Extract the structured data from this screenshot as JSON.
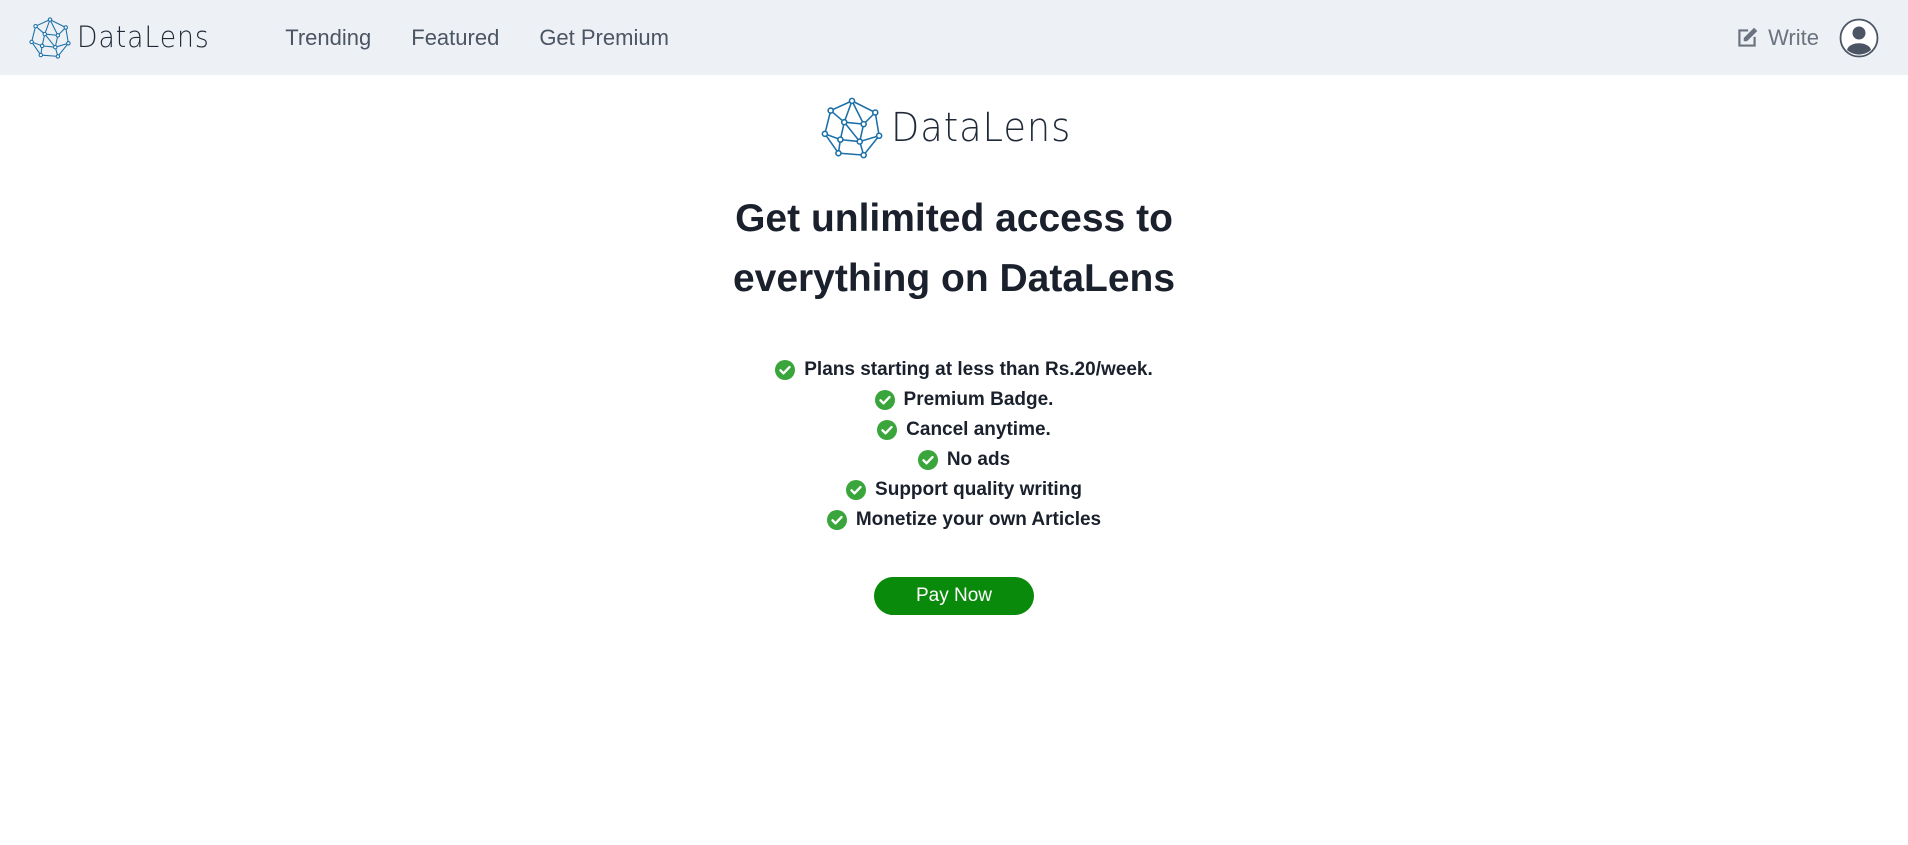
{
  "navbar": {
    "brand": {
      "name": "DataLens",
      "icon": "network-logo-icon"
    },
    "links": [
      {
        "label": "Trending"
      },
      {
        "label": "Featured"
      },
      {
        "label": "Get Premium"
      }
    ],
    "write": {
      "label": "Write",
      "icon": "edit-icon"
    },
    "avatar": {
      "icon": "user-avatar-icon"
    }
  },
  "main": {
    "logo_text": "DataLens",
    "headline": "Get unlimited access to everything on DataLens",
    "features": [
      "Plans starting at less than Rs.20/week.",
      "Premium Badge.",
      "Cancel anytime.",
      "No ads",
      "Support quality writing",
      "Monetize your own Articles"
    ],
    "pay_button_label": "Pay Now"
  },
  "colors": {
    "navbar_bg": "#edf1f5",
    "logo_blue": "#1b6fa8",
    "check_green": "#3aa53a",
    "pay_button_bg": "#0a8a0a",
    "text_dark": "#1a202c"
  }
}
